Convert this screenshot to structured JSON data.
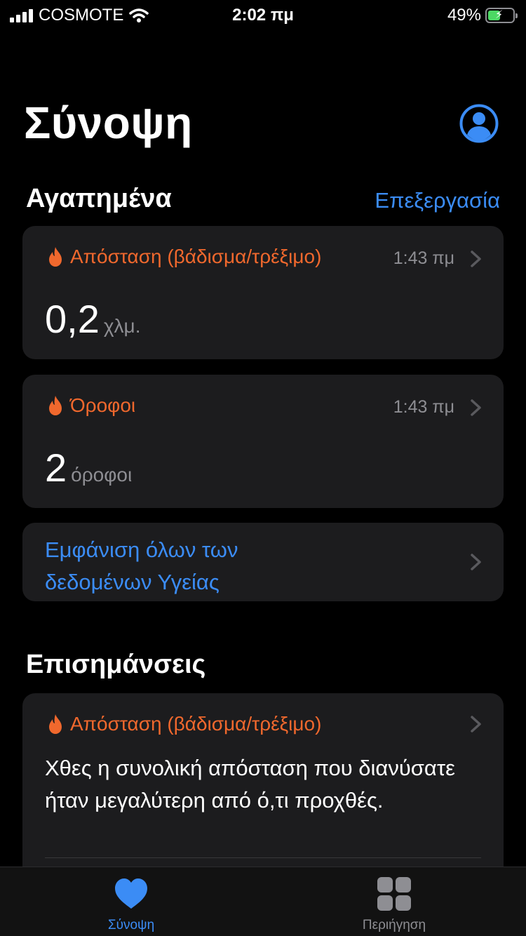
{
  "status_bar": {
    "carrier": "COSMOTE",
    "time": "2:02 πμ",
    "battery_percent": "49%",
    "battery_level": 0.49
  },
  "header": {
    "title": "Σύνοψη"
  },
  "favorites": {
    "title": "Αγαπημένα",
    "edit_label": "Επεξεργασία",
    "cards": [
      {
        "title": "Απόσταση (βάδισμα/τρέξιμο)",
        "time": "1:43 πμ",
        "value": "0,2",
        "unit": "χλμ."
      },
      {
        "title": "Όροφοι",
        "time": "1:43 πμ",
        "value": "2",
        "unit": "όροφοι"
      }
    ],
    "show_all_label": "Εμφάνιση όλων των δεδομένων Υγείας"
  },
  "highlights": {
    "title": "Επισημάνσεις",
    "card": {
      "title": "Απόσταση (βάδισμα/τρέξιμο)",
      "text": "Χθες η συνολική απόσταση που διανύσατε ήταν μεγαλύτερη από ό,τι προχθές."
    }
  },
  "tab_bar": {
    "tabs": [
      {
        "label": "Σύνοψη",
        "active": true
      },
      {
        "label": "Περιήγηση",
        "active": false
      }
    ]
  },
  "colors": {
    "accent_blue": "#3b8cf5",
    "activity_orange": "#f0682d",
    "card_bg": "#1c1c1e",
    "secondary_text": "#8e8e93",
    "battery_green": "#4cd964"
  },
  "icons": {
    "profile": "person-circle-icon",
    "card_category": "flame-icon",
    "disclosure": "chevron-right-icon",
    "tab_summary": "heart-icon",
    "tab_browse": "grid-icon"
  }
}
